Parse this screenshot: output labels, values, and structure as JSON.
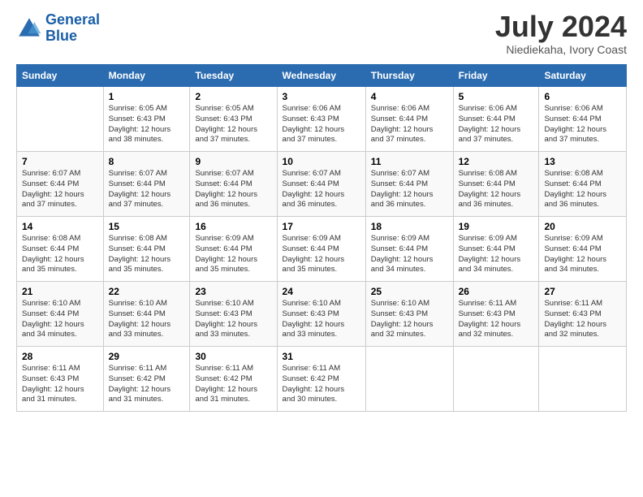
{
  "logo": {
    "line1": "General",
    "line2": "Blue"
  },
  "title": "July 2024",
  "location": "Niediekaha, Ivory Coast",
  "days_of_week": [
    "Sunday",
    "Monday",
    "Tuesday",
    "Wednesday",
    "Thursday",
    "Friday",
    "Saturday"
  ],
  "weeks": [
    [
      {
        "day": "",
        "sunrise": "",
        "sunset": "",
        "daylight": ""
      },
      {
        "day": "1",
        "sunrise": "6:05 AM",
        "sunset": "6:43 PM",
        "daylight": "12 hours and 38 minutes."
      },
      {
        "day": "2",
        "sunrise": "6:05 AM",
        "sunset": "6:43 PM",
        "daylight": "12 hours and 37 minutes."
      },
      {
        "day": "3",
        "sunrise": "6:06 AM",
        "sunset": "6:43 PM",
        "daylight": "12 hours and 37 minutes."
      },
      {
        "day": "4",
        "sunrise": "6:06 AM",
        "sunset": "6:44 PM",
        "daylight": "12 hours and 37 minutes."
      },
      {
        "day": "5",
        "sunrise": "6:06 AM",
        "sunset": "6:44 PM",
        "daylight": "12 hours and 37 minutes."
      },
      {
        "day": "6",
        "sunrise": "6:06 AM",
        "sunset": "6:44 PM",
        "daylight": "12 hours and 37 minutes."
      }
    ],
    [
      {
        "day": "7",
        "sunrise": "6:07 AM",
        "sunset": "6:44 PM",
        "daylight": "12 hours and 37 minutes."
      },
      {
        "day": "8",
        "sunrise": "6:07 AM",
        "sunset": "6:44 PM",
        "daylight": "12 hours and 37 minutes."
      },
      {
        "day": "9",
        "sunrise": "6:07 AM",
        "sunset": "6:44 PM",
        "daylight": "12 hours and 36 minutes."
      },
      {
        "day": "10",
        "sunrise": "6:07 AM",
        "sunset": "6:44 PM",
        "daylight": "12 hours and 36 minutes."
      },
      {
        "day": "11",
        "sunrise": "6:07 AM",
        "sunset": "6:44 PM",
        "daylight": "12 hours and 36 minutes."
      },
      {
        "day": "12",
        "sunrise": "6:08 AM",
        "sunset": "6:44 PM",
        "daylight": "12 hours and 36 minutes."
      },
      {
        "day": "13",
        "sunrise": "6:08 AM",
        "sunset": "6:44 PM",
        "daylight": "12 hours and 36 minutes."
      }
    ],
    [
      {
        "day": "14",
        "sunrise": "6:08 AM",
        "sunset": "6:44 PM",
        "daylight": "12 hours and 35 minutes."
      },
      {
        "day": "15",
        "sunrise": "6:08 AM",
        "sunset": "6:44 PM",
        "daylight": "12 hours and 35 minutes."
      },
      {
        "day": "16",
        "sunrise": "6:09 AM",
        "sunset": "6:44 PM",
        "daylight": "12 hours and 35 minutes."
      },
      {
        "day": "17",
        "sunrise": "6:09 AM",
        "sunset": "6:44 PM",
        "daylight": "12 hours and 35 minutes."
      },
      {
        "day": "18",
        "sunrise": "6:09 AM",
        "sunset": "6:44 PM",
        "daylight": "12 hours and 34 minutes."
      },
      {
        "day": "19",
        "sunrise": "6:09 AM",
        "sunset": "6:44 PM",
        "daylight": "12 hours and 34 minutes."
      },
      {
        "day": "20",
        "sunrise": "6:09 AM",
        "sunset": "6:44 PM",
        "daylight": "12 hours and 34 minutes."
      }
    ],
    [
      {
        "day": "21",
        "sunrise": "6:10 AM",
        "sunset": "6:44 PM",
        "daylight": "12 hours and 34 minutes."
      },
      {
        "day": "22",
        "sunrise": "6:10 AM",
        "sunset": "6:44 PM",
        "daylight": "12 hours and 33 minutes."
      },
      {
        "day": "23",
        "sunrise": "6:10 AM",
        "sunset": "6:43 PM",
        "daylight": "12 hours and 33 minutes."
      },
      {
        "day": "24",
        "sunrise": "6:10 AM",
        "sunset": "6:43 PM",
        "daylight": "12 hours and 33 minutes."
      },
      {
        "day": "25",
        "sunrise": "6:10 AM",
        "sunset": "6:43 PM",
        "daylight": "12 hours and 32 minutes."
      },
      {
        "day": "26",
        "sunrise": "6:11 AM",
        "sunset": "6:43 PM",
        "daylight": "12 hours and 32 minutes."
      },
      {
        "day": "27",
        "sunrise": "6:11 AM",
        "sunset": "6:43 PM",
        "daylight": "12 hours and 32 minutes."
      }
    ],
    [
      {
        "day": "28",
        "sunrise": "6:11 AM",
        "sunset": "6:43 PM",
        "daylight": "12 hours and 31 minutes."
      },
      {
        "day": "29",
        "sunrise": "6:11 AM",
        "sunset": "6:42 PM",
        "daylight": "12 hours and 31 minutes."
      },
      {
        "day": "30",
        "sunrise": "6:11 AM",
        "sunset": "6:42 PM",
        "daylight": "12 hours and 31 minutes."
      },
      {
        "day": "31",
        "sunrise": "6:11 AM",
        "sunset": "6:42 PM",
        "daylight": "12 hours and 30 minutes."
      },
      {
        "day": "",
        "sunrise": "",
        "sunset": "",
        "daylight": ""
      },
      {
        "day": "",
        "sunrise": "",
        "sunset": "",
        "daylight": ""
      },
      {
        "day": "",
        "sunrise": "",
        "sunset": "",
        "daylight": ""
      }
    ]
  ]
}
